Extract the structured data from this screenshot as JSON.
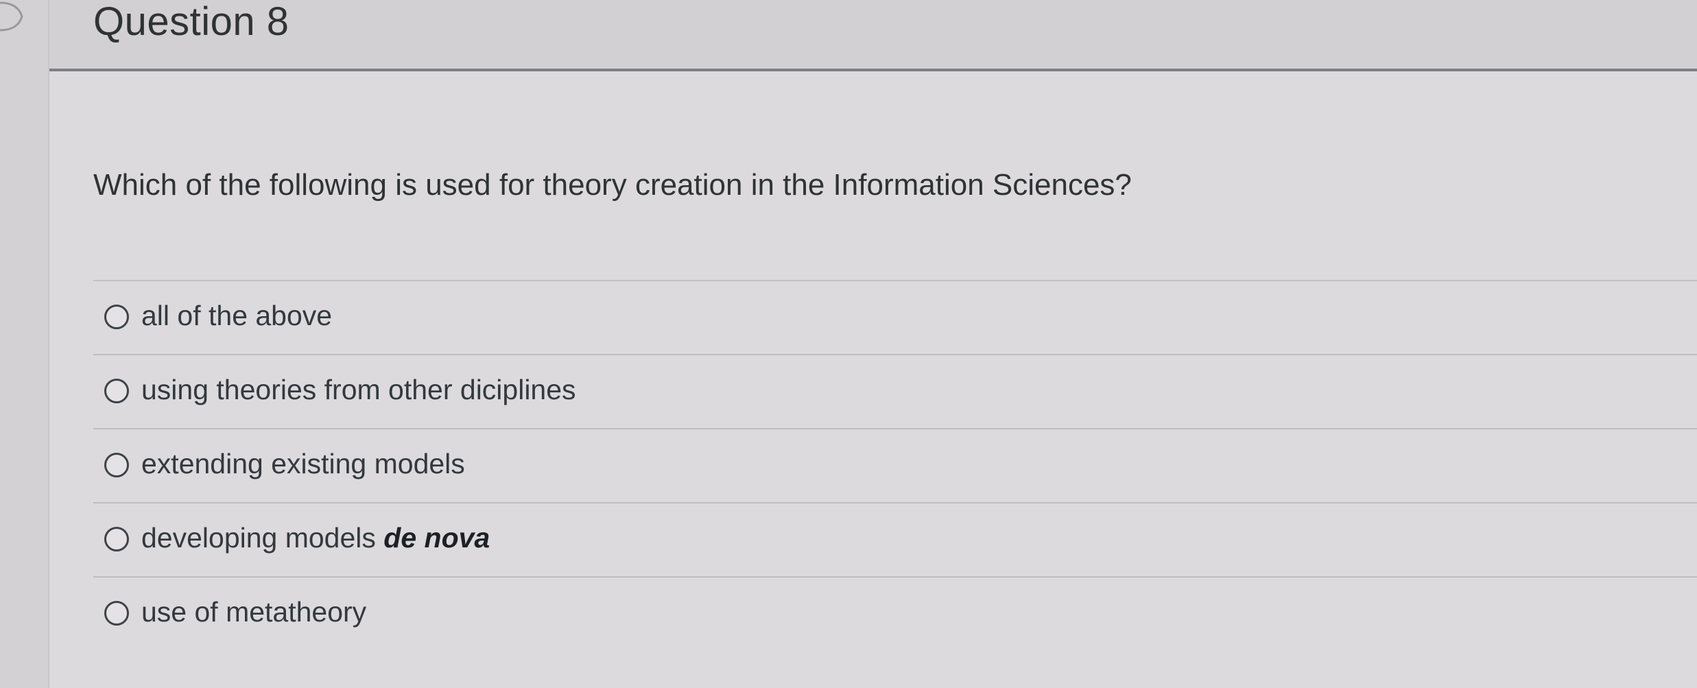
{
  "question": {
    "title": "Question 8",
    "text": "Which of the following is used for theory creation in the Information Sciences?",
    "answers": [
      {
        "label": "all of the above",
        "selected": false
      },
      {
        "label": "using theories from other diciplines",
        "selected": false
      },
      {
        "label": "extending existing models",
        "selected": false
      },
      {
        "label": "developing models ",
        "emphasis": "de nova",
        "selected": false
      },
      {
        "label": "use of metatheory",
        "selected": false
      }
    ]
  },
  "colors": {
    "background": "#dcdadd",
    "header_background": "#d2d0d3",
    "header_border": "#7b7f86",
    "text": "#2f3336"
  },
  "icons": {
    "collapse": "chevron-right-icon",
    "radio": "radio-button-icon"
  }
}
